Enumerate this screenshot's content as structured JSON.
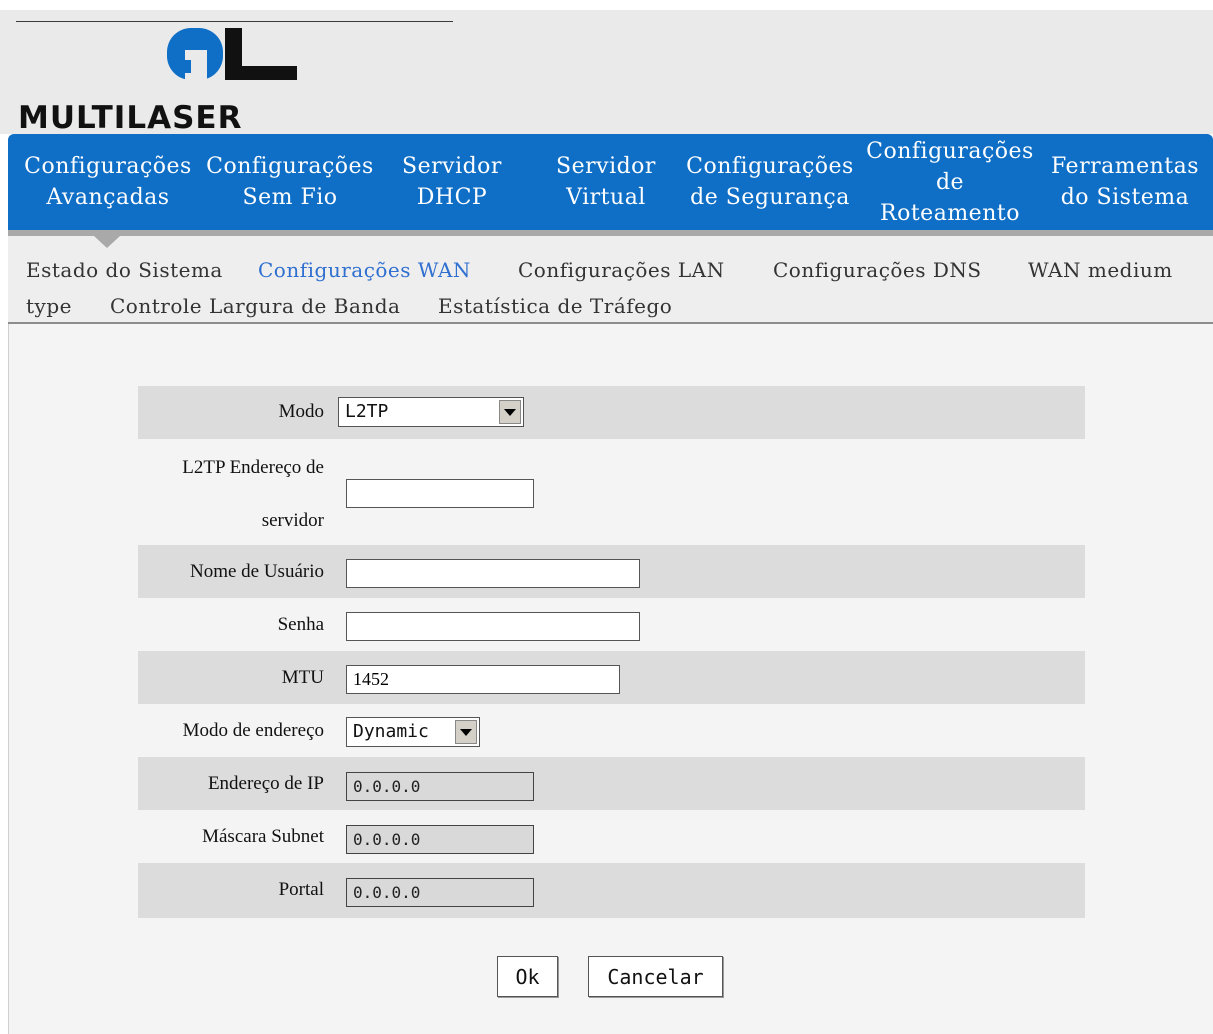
{
  "brand": {
    "name": "MULTILASER",
    "logo_icon": "multilaser-ml-mark",
    "accent_color": "#0f6ec6",
    "logo_color": "#0f6ec6"
  },
  "main_nav": {
    "items": [
      {
        "label": "Configurações\nAvançadas",
        "active": true
      },
      {
        "label": "Configurações\nSem Fio"
      },
      {
        "label": "Servidor\nDHCP"
      },
      {
        "label": "Servidor\nVirtual"
      },
      {
        "label": "Configurações\nde Segurança"
      },
      {
        "label": "Configurações\nde\nRoteamento"
      },
      {
        "label": "Ferramentas\ndo Sistema"
      }
    ]
  },
  "sub_nav": {
    "items": [
      {
        "label": "Estado do Sistema"
      },
      {
        "label": "Configurações WAN",
        "active": true
      },
      {
        "label": "Configurações LAN"
      },
      {
        "label": "Configurações DNS"
      },
      {
        "label": "WAN medium"
      },
      {
        "label": "type"
      },
      {
        "label": "Controle Largura de Banda"
      },
      {
        "label": "Estatística de Tráfego"
      }
    ]
  },
  "form": {
    "mode": {
      "label": "Modo",
      "value": "L2TP"
    },
    "server": {
      "label_line1": "L2TP Endereço de",
      "label_line2": "servidor",
      "value": ""
    },
    "username": {
      "label": "Nome de Usuário",
      "value": ""
    },
    "password": {
      "label": "Senha",
      "value": ""
    },
    "mtu": {
      "label": "MTU",
      "value": "1452"
    },
    "address_mode": {
      "label": "Modo de endereço",
      "value": "Dynamic"
    },
    "ip": {
      "label": "Endereço de IP",
      "value": "0.0.0.0"
    },
    "subnet": {
      "label": "Máscara Subnet",
      "value": "0.0.0.0"
    },
    "gateway": {
      "label": "Portal",
      "value": "0.0.0.0"
    }
  },
  "buttons": {
    "ok": "Ok",
    "cancel": "Cancelar"
  }
}
